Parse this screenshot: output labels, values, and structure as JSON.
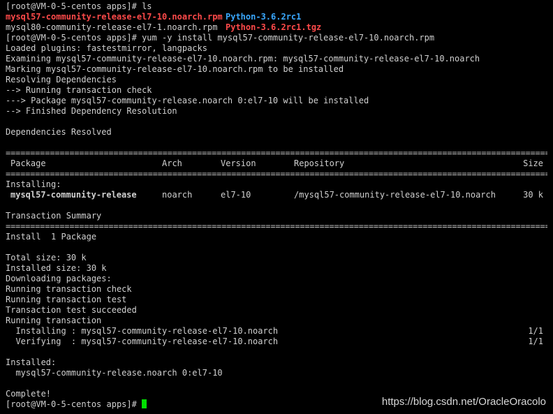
{
  "ls_cmd": "[root@VM-0-5-centos apps]# ls",
  "ls_row1": {
    "rpm57": "mysql57-community-release-el7-10.noarch.rpm",
    "pydir": "Python-3.6.2rc1"
  },
  "ls_row2": {
    "rpm80": "mysql80-community-release-el7-1.noarch.rpm",
    "pytgz": "Python-3.6.2rc1.tgz"
  },
  "out1": [
    "[root@VM-0-5-centos apps]# yum -y install mysql57-community-release-el7-10.noarch.rpm",
    "Loaded plugins: fastestmirror, langpacks",
    "Examining mysql57-community-release-el7-10.noarch.rpm: mysql57-community-release-el7-10.noarch",
    "Marking mysql57-community-release-el7-10.noarch.rpm to be installed",
    "Resolving Dependencies",
    "--> Running transaction check",
    "---> Package mysql57-community-release.noarch 0:el7-10 will be installed",
    "--> Finished Dependency Resolution",
    "",
    "Dependencies Resolved",
    ""
  ],
  "rule": "================================================================================================================================================================================",
  "header": {
    "package": "Package",
    "arch": "Arch",
    "version": "Version",
    "repository": "Repository",
    "size": "Size"
  },
  "installing_label": "Installing:",
  "pkg_row": {
    "package": "mysql57-community-release",
    "arch": "noarch",
    "version": "el7-10",
    "repository": "/mysql57-community-release-el7-10.noarch",
    "size": "30 k"
  },
  "txn_summary": "Transaction Summary",
  "out2": [
    "Install  1 Package",
    "",
    "Total size: 30 k",
    "Installed size: 30 k",
    "Downloading packages:",
    "Running transaction check",
    "Running transaction test",
    "Transaction test succeeded",
    "Running transaction"
  ],
  "progress": [
    {
      "text": "  Installing : mysql57-community-release-el7-10.noarch",
      "count": "1/1"
    },
    {
      "text": "  Verifying  : mysql57-community-release-el7-10.noarch",
      "count": "1/1"
    }
  ],
  "out3": [
    "",
    "Installed:",
    "  mysql57-community-release.noarch 0:el7-10",
    "",
    "Complete!"
  ],
  "final_prompt": "[root@VM-0-5-centos apps]# ",
  "watermark": "https://blog.csdn.net/OracleOracolo",
  "colors": {
    "bg": "#000000",
    "text": "#d0d0d0",
    "red": "#ff4a4a",
    "blue": "#3aa8ff",
    "cursor": "#00e000"
  }
}
